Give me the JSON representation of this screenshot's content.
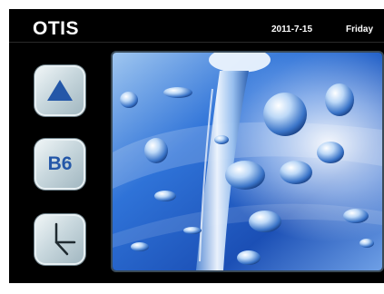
{
  "header": {
    "brand": "OTIS",
    "date": "2011-7-15",
    "day": "Friday"
  },
  "floor": {
    "current": "B6",
    "direction": "up"
  },
  "icons": {
    "direction": "up-arrow-icon",
    "clock": "clock-icon"
  },
  "colors": {
    "background": "#000000",
    "tile": "#c9d8de",
    "accent_blue": "#2457a8"
  }
}
